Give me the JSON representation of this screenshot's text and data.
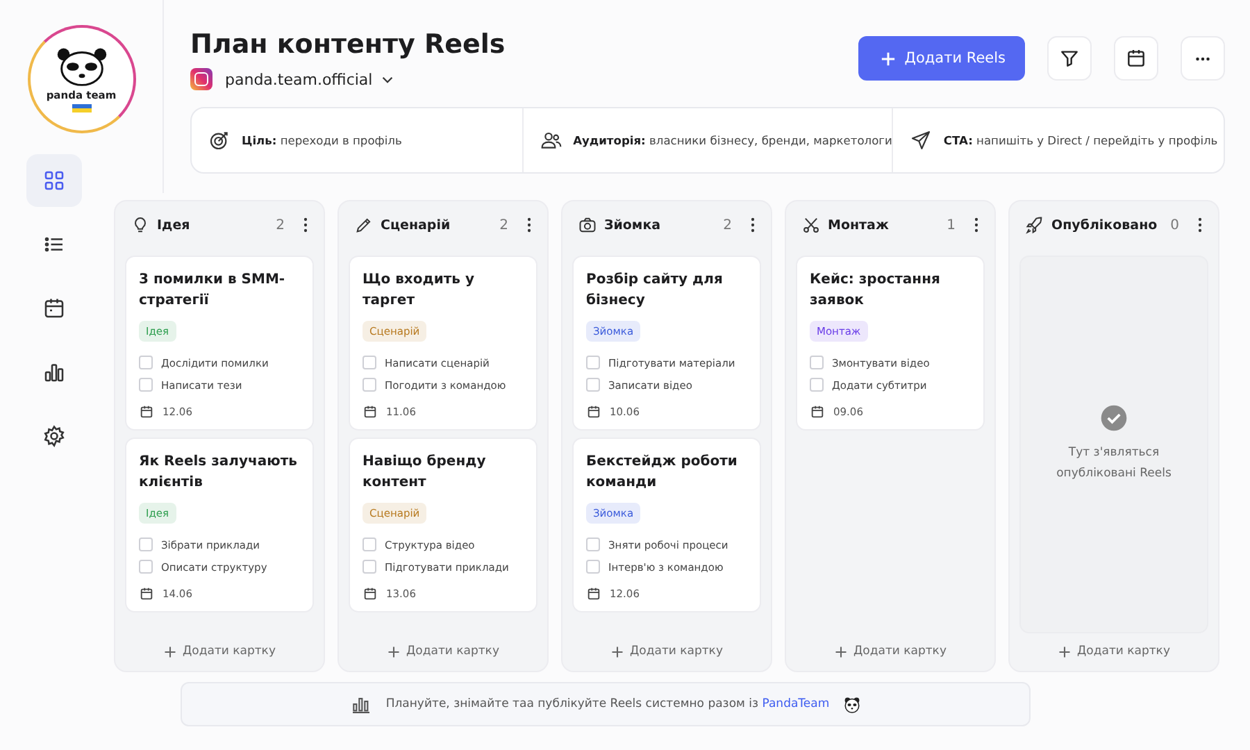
{
  "logo": {
    "text": "panda team"
  },
  "nav": [
    {
      "kind": "board",
      "selected": true
    },
    {
      "kind": "list",
      "selected": false
    },
    {
      "kind": "calendar",
      "selected": false
    },
    {
      "kind": "stats",
      "selected": false
    },
    {
      "kind": "settings",
      "selected": false
    }
  ],
  "header": {
    "title": "План контенту Reels",
    "account": "panda.team.official",
    "add_button": "Додати Reels"
  },
  "info": [
    {
      "kind": "goal",
      "label": "Ціль:",
      "text": "переходи в профіль"
    },
    {
      "kind": "audience",
      "label": "Аудиторія:",
      "text": "власники бізнесу, бренди, маркетологи"
    },
    {
      "kind": "cta",
      "label": "CTA:",
      "text": "напишіть у Direct / перейдіть у профіль"
    }
  ],
  "columns": [
    {
      "kind": "idea",
      "title": "Ідея",
      "count": "2",
      "cards": [
        {
          "title": "3 помилки в SMM-стратегії",
          "tag": "Ідея",
          "color": "#2e9e4f",
          "tasks": [
            {
              "text": "Дослідити помилки",
              "checked": false
            },
            {
              "text": "Написати тези",
              "checked": false
            }
          ],
          "date": "12.06"
        },
        {
          "title": "Як Reels залучають клієнтів",
          "tag": "Ідея",
          "color": "#2e9e4f",
          "tasks": [
            {
              "text": "Зібрати приклади",
              "checked": false
            },
            {
              "text": "Описати структуру",
              "checked": false
            }
          ],
          "date": "14.06"
        }
      ],
      "add": "Додати картку"
    },
    {
      "kind": "script",
      "title": "Сценарій",
      "count": "2",
      "cards": [
        {
          "title": "Що входить у таргет",
          "tag": "Сценарій",
          "color": "#b7791f",
          "tasks": [
            {
              "text": "Написати сценарій",
              "checked": false
            },
            {
              "text": "Погодити з командою",
              "checked": false
            }
          ],
          "date": "11.06"
        },
        {
          "title": "Навіщо бренду контент",
          "tag": "Сценарій",
          "color": "#b7791f",
          "tasks": [
            {
              "text": "Структура відео",
              "checked": false
            },
            {
              "text": "Підготувати приклади",
              "checked": false
            }
          ],
          "date": "13.06"
        }
      ],
      "add": "Додати картку"
    },
    {
      "kind": "shoot",
      "title": "Зйомка",
      "count": "2",
      "cards": [
        {
          "title": "Розбір сайту для бізнесу",
          "tag": "Зйомка",
          "color": "#3b5bdb",
          "tasks": [
            {
              "text": "Підготувати матеріали",
              "checked": false
            },
            {
              "text": "Записати відео",
              "checked": false
            }
          ],
          "date": "10.06"
        },
        {
          "title": "Бекстейдж роботи команди",
          "tag": "Зйомка",
          "color": "#3b5bdb",
          "tasks": [
            {
              "text": "Зняти робочі процеси",
              "checked": false
            },
            {
              "text": "Інтерв'ю з командою",
              "checked": false
            }
          ],
          "date": "12.06"
        }
      ],
      "add": "Додати картку"
    },
    {
      "kind": "edit",
      "title": "Монтаж",
      "count": "1",
      "cards": [
        {
          "title": "Кейс: зростання заявок",
          "tag": "Монтаж",
          "color": "#6a3de8",
          "tasks": [
            {
              "text": "Змонтувати відео",
              "checked": false
            },
            {
              "text": "Додати субтитри",
              "checked": false
            }
          ],
          "date": "09.06"
        }
      ],
      "add": "Додати картку"
    },
    {
      "kind": "published",
      "title": "Опубліковано",
      "count": "0",
      "empty": "Тут з'являться опубліковані Reels",
      "add": "Додати картку"
    }
  ],
  "footer": {
    "text": "Плануйте, знімайте таа публікуйте Reels системно разом із",
    "link": "PandaTeam"
  }
}
